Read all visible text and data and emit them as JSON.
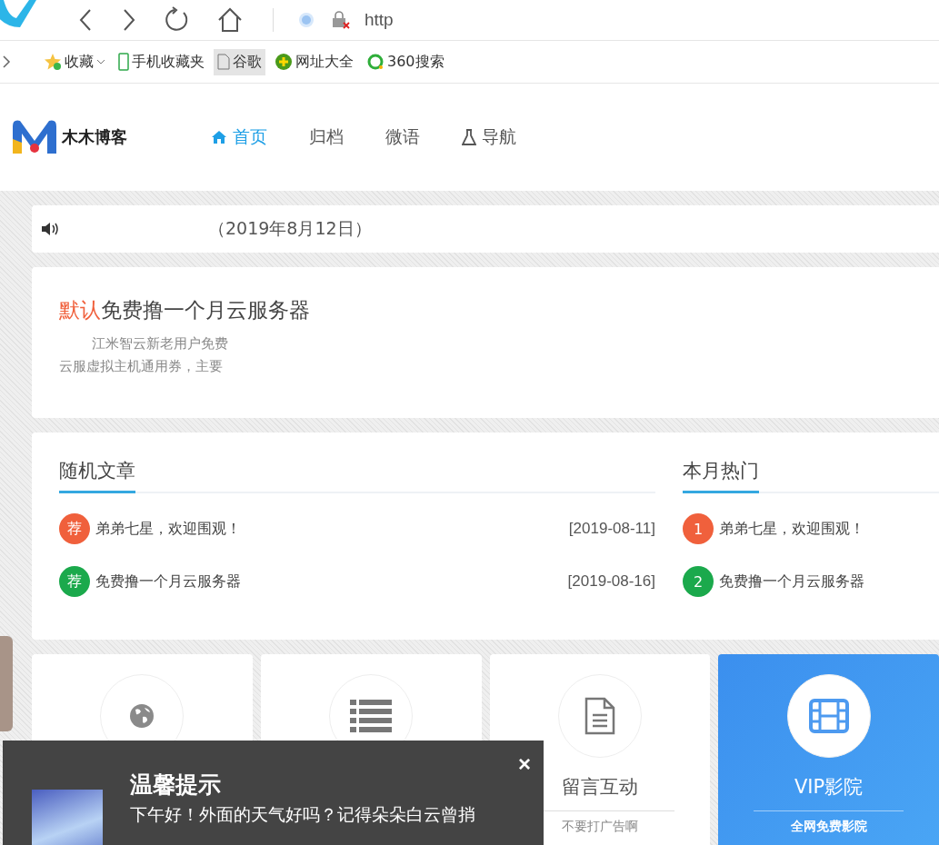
{
  "browser": {
    "address": "http",
    "bookmarks": [
      {
        "label": "收藏",
        "dropdown": true,
        "selected": false
      },
      {
        "label": "手机收藏夹",
        "dropdown": false,
        "selected": false
      },
      {
        "label": "谷歌",
        "dropdown": false,
        "selected": true
      },
      {
        "label": "网址大全",
        "dropdown": false,
        "selected": false
      },
      {
        "label": "360搜索",
        "dropdown": false,
        "selected": false
      }
    ]
  },
  "site": {
    "logo_text": "木木博客",
    "nav": [
      {
        "label": "首页",
        "selected": true
      },
      {
        "label": "归档",
        "selected": false
      },
      {
        "label": "微语",
        "selected": false
      },
      {
        "label": "导航",
        "selected": false
      }
    ]
  },
  "notice": {
    "text": "（2019年8月12日）"
  },
  "post": {
    "tag": "默认",
    "title": "免费撸一个月云服务器",
    "excerpt_1": "江米智云新老用户免费",
    "excerpt_2": "云服虚拟主机通用券，主要"
  },
  "random_articles": {
    "title": "随机文章",
    "items": [
      {
        "badge": "荐",
        "color": "#f0603c",
        "title": "弟弟七星，欢迎围观！",
        "date": "[2019-08-11]"
      },
      {
        "badge": "荐",
        "color": "#1ba94c",
        "title": "免费撸一个月云服务器",
        "date": "[2019-08-16]"
      }
    ]
  },
  "hot_this_month": {
    "title": "本月热门",
    "items": [
      {
        "rank": "1",
        "color": "#f0603c",
        "title": "弟弟七星，欢迎围观！"
      },
      {
        "rank": "2",
        "color": "#1ba94c",
        "title": "免费撸一个月云服务器"
      }
    ]
  },
  "tiles": [
    {
      "kind": "plain"
    },
    {
      "kind": "plain"
    },
    {
      "kind": "plain",
      "title": "留言互动",
      "subtitle": "不要打广告啊"
    },
    {
      "kind": "featured",
      "title": "VIP影院",
      "subtitle": "全网免费影院"
    }
  ],
  "popup": {
    "title": "温馨提示",
    "text": "下午好！外面的天气好吗？记得朵朵白云曾捎",
    "close": "×"
  }
}
